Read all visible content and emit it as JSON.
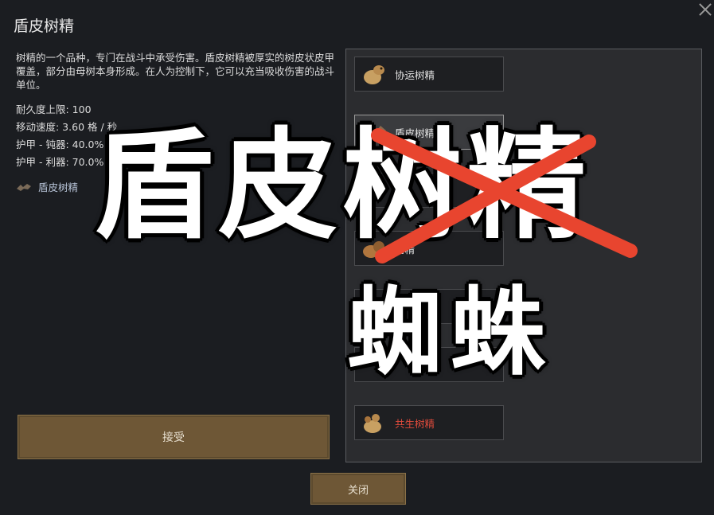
{
  "dialog": {
    "title": "盾皮树精",
    "description": "树精的一个品种，专门在战斗中承受伤害。盾皮树精被厚实的树皮状皮甲覆盖，部分由母树本身形成。在人为控制下，它可以充当吸收伤害的战斗单位。",
    "stats": [
      "耐久度上限: 100",
      "移动速度: 3.60 格 / 秒",
      "护甲 - 钝器: 40.0%",
      "护甲 - 利器: 70.0%"
    ],
    "type_link": "盾皮树精",
    "accept_label": "接受",
    "close_label": "关闭"
  },
  "list": {
    "items": [
      {
        "label": "协运树精",
        "icon": "dryad-carrier-icon",
        "selected": false
      },
      {
        "label": "盾皮树精",
        "icon": "dryad-barkskin-icon",
        "selected": true
      },
      {
        "label": "",
        "icon": "",
        "selected": false
      },
      {
        "label": "树精",
        "icon": "dryad-icon",
        "selected": false
      },
      {
        "label": "",
        "icon": "",
        "selected": false
      },
      {
        "label": "",
        "icon": "",
        "selected": false
      },
      {
        "label": "共生树精",
        "icon": "dryad-symbiote-icon",
        "selected": false,
        "color": "#e04b3c"
      }
    ]
  },
  "overlay": {
    "line1": "盾皮树精",
    "line2": "蜘蛛",
    "strike_color": "#e8452f"
  }
}
